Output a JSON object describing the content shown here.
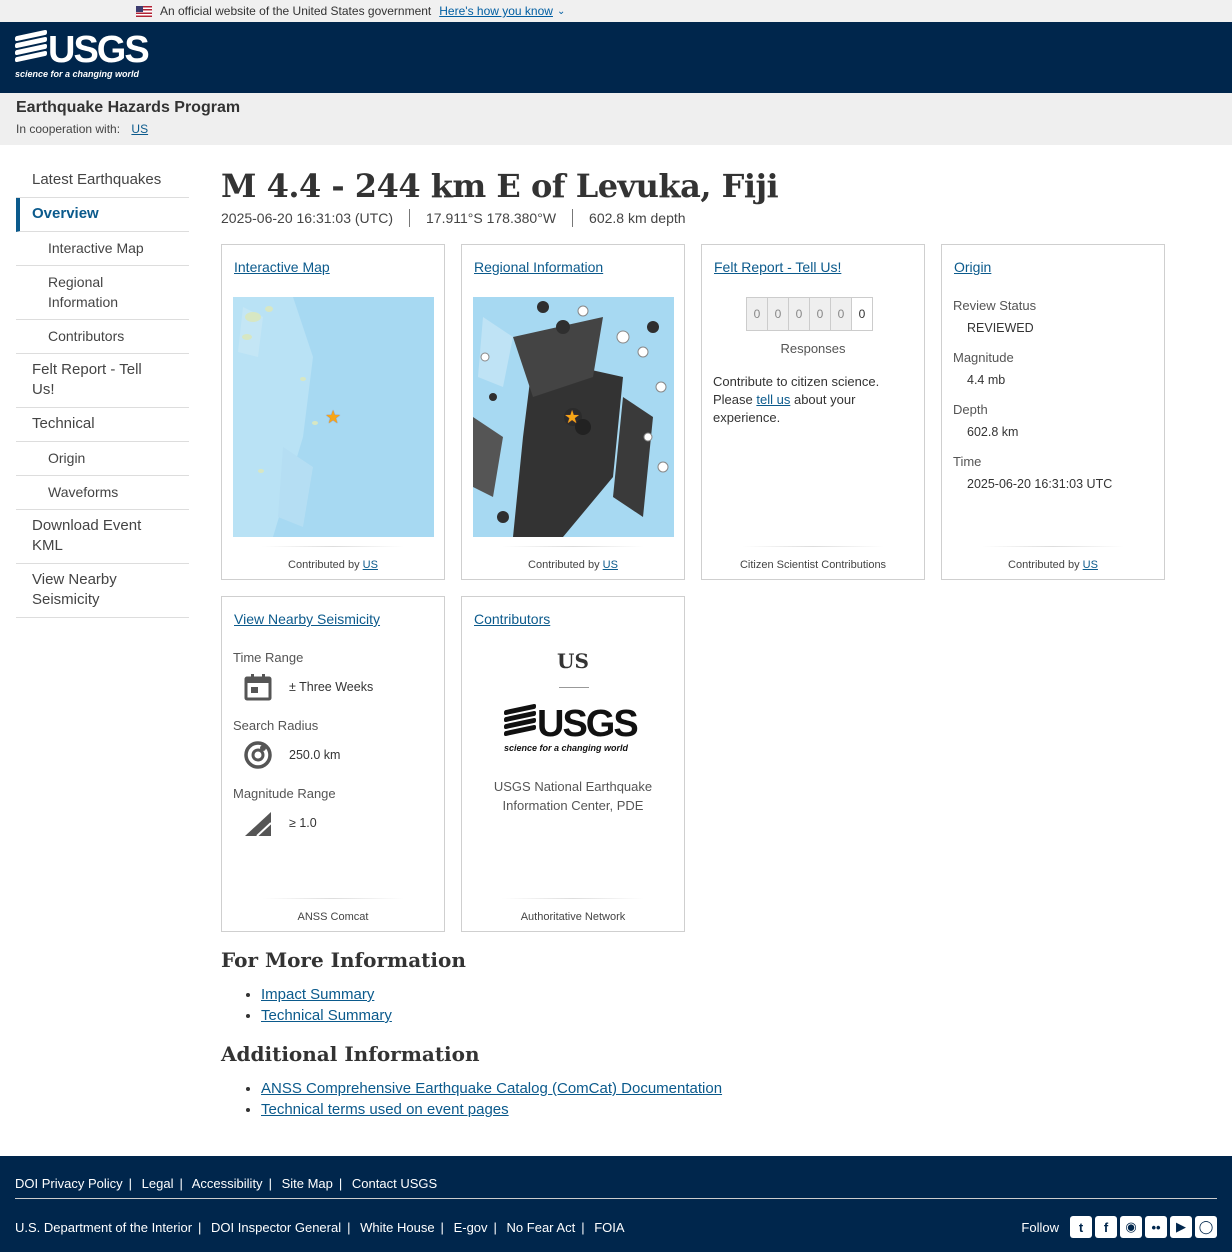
{
  "gov_banner": {
    "text": "An official website of the United States government",
    "how_link": "Here's how you know"
  },
  "header": {
    "logo_text": "USGS",
    "logo_tagline": "science for a changing world"
  },
  "program": {
    "title": "Earthquake Hazards Program",
    "coop_label": "In cooperation with:",
    "coop_link": "US"
  },
  "sidebar": {
    "items": [
      {
        "label": "Latest Earthquakes"
      },
      {
        "label": "Overview"
      },
      {
        "label": "Interactive Map"
      },
      {
        "label": "Regional Information"
      },
      {
        "label": "Contributors"
      },
      {
        "label": "Felt Report - Tell Us!"
      },
      {
        "label": "Technical"
      },
      {
        "label": "Origin"
      },
      {
        "label": "Waveforms"
      },
      {
        "label": "Download Event KML"
      },
      {
        "label": "View Nearby Seismicity"
      }
    ]
  },
  "event": {
    "title": "M 4.4 - 244 km E of Levuka, Fiji",
    "time": "2025-06-20 16:31:03 (UTC)",
    "location": "17.911°S 178.380°W",
    "depth": "602.8 km depth"
  },
  "cards": {
    "interactive_map": {
      "title": "Interactive Map",
      "foot_prefix": "Contributed by",
      "foot_link": "US"
    },
    "regional": {
      "title": "Regional Information",
      "foot_prefix": "Contributed by",
      "foot_link": "US"
    },
    "felt": {
      "title": "Felt Report - Tell Us!",
      "digits": [
        "0",
        "0",
        "0",
        "0",
        "0",
        "0"
      ],
      "responses_label": "Responses",
      "text_before": "Contribute to citizen science. Please",
      "text_link": "tell us",
      "text_after": "about your experience.",
      "foot": "Citizen Scientist Contributions"
    },
    "origin": {
      "title": "Origin",
      "review_label": "Review Status",
      "review_value": "REVIEWED",
      "mag_label": "Magnitude",
      "mag_value": "4.4 mb",
      "depth_label": "Depth",
      "depth_value": "602.8 km",
      "time_label": "Time",
      "time_value": "2025-06-20 16:31:03 UTC",
      "foot_prefix": "Contributed by",
      "foot_link": "US"
    },
    "nearby": {
      "title": "View Nearby Seismicity",
      "time_label": "Time Range",
      "time_value": "± Three Weeks",
      "radius_label": "Search Radius",
      "radius_value": "250.0 km",
      "mag_label": "Magnitude Range",
      "mag_value": "≥ 1.0",
      "foot": "ANSS Comcat"
    },
    "contributors": {
      "title": "Contributors",
      "network": "US",
      "logo_text": "USGS",
      "logo_tagline": "science for a changing world",
      "name": "USGS National Earthquake Information Center, PDE",
      "foot": "Authoritative Network"
    }
  },
  "more_info": {
    "heading": "For More Information",
    "links": [
      "Impact Summary",
      "Technical Summary"
    ]
  },
  "additional_info": {
    "heading": "Additional Information",
    "links": [
      "ANSS Comprehensive Earthquake Catalog (ComCat) Documentation",
      "Technical terms used on event pages"
    ]
  },
  "footer": {
    "row1": [
      "DOI Privacy Policy",
      "Legal",
      "Accessibility",
      "Site Map",
      "Contact USGS"
    ],
    "row2": [
      "U.S. Department of the Interior",
      "DOI Inspector General",
      "White House",
      "E-gov",
      "No Fear Act",
      "FOIA"
    ],
    "follow_label": "Follow",
    "social_icons": [
      "twitter-icon",
      "facebook-icon",
      "github-icon",
      "flickr-icon",
      "youtube-icon",
      "instagram-icon"
    ]
  },
  "colors": {
    "header_bg": "#00264c",
    "link": "#0b5a8c",
    "star": "#f7a616",
    "map_water": "#a7d9f2"
  }
}
